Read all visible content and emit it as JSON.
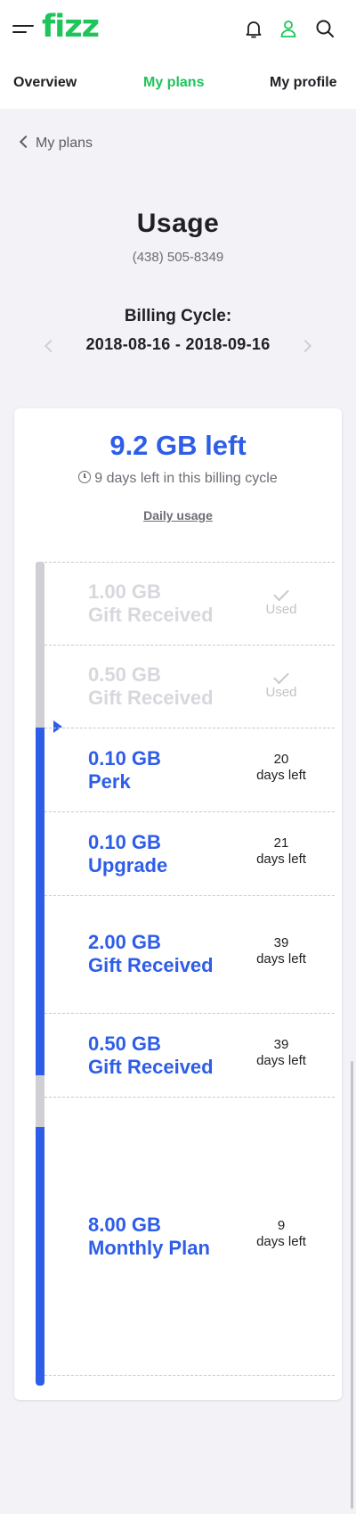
{
  "header": {
    "logo": "fizz",
    "icons": [
      "menu-icon",
      "bell-icon",
      "user-icon",
      "search-icon"
    ]
  },
  "nav": {
    "tabs": [
      {
        "label": "Overview",
        "active": false
      },
      {
        "label": "My plans",
        "active": true
      },
      {
        "label": "My profile",
        "active": false
      }
    ]
  },
  "breadcrumb": {
    "label": "My plans"
  },
  "usage": {
    "title": "Usage",
    "phone": "(438) 505-8349",
    "billing_label": "Billing Cycle:",
    "cycle_dates": "2018-08-16 - 2018-09-16"
  },
  "card": {
    "gb_left": "9.2 GB left",
    "days_left_cycle": "9 days left in this billing cycle",
    "daily_usage_link": "Daily usage",
    "items": [
      {
        "amount": "1.00 GB",
        "label": "Gift Received",
        "status": "Used",
        "used": true
      },
      {
        "amount": "0.50 GB",
        "label": "Gift Received",
        "status": "Used",
        "used": true
      },
      {
        "amount": "0.10 GB",
        "label": "Perk",
        "days": "20",
        "days_label": "days left",
        "used": false
      },
      {
        "amount": "0.10 GB",
        "label": "Upgrade",
        "days": "21",
        "days_label": "days left",
        "used": false
      },
      {
        "amount": "2.00 GB",
        "label": "Gift Received",
        "days": "39",
        "days_label": "days left",
        "used": false
      },
      {
        "amount": "0.50 GB",
        "label": "Gift Received",
        "days": "39",
        "days_label": "days left",
        "used": false
      },
      {
        "amount": "8.00 GB",
        "label": "Monthly Plan",
        "days": "9",
        "days_label": "days left",
        "used": false
      }
    ]
  },
  "colors": {
    "brand_green": "#1ec559",
    "accent_blue": "#2e5de8",
    "used_grey": "#cfcfd4",
    "background": "#f2f2f7"
  }
}
